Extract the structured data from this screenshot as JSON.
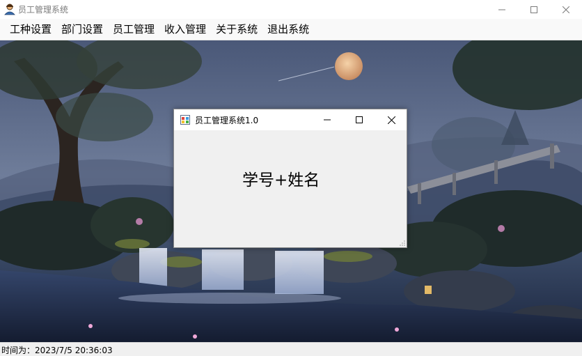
{
  "window": {
    "title": "员工管理系统",
    "icon": "user-icon"
  },
  "menu": {
    "items": [
      {
        "label": "工种设置"
      },
      {
        "label": "部门设置"
      },
      {
        "label": "员工管理"
      },
      {
        "label": "收入管理"
      },
      {
        "label": "关于系统"
      },
      {
        "label": "退出系统"
      }
    ]
  },
  "dialog": {
    "title": "员工管理系统1.0",
    "icon": "app-form-icon",
    "label": "学号+姓名"
  },
  "status": {
    "text": "时间为：2023/7/5 20:36:03"
  },
  "colors": {
    "accent": "#0078d7",
    "scene_sky": "#3b4a6b",
    "scene_water": "#1d2a44"
  }
}
